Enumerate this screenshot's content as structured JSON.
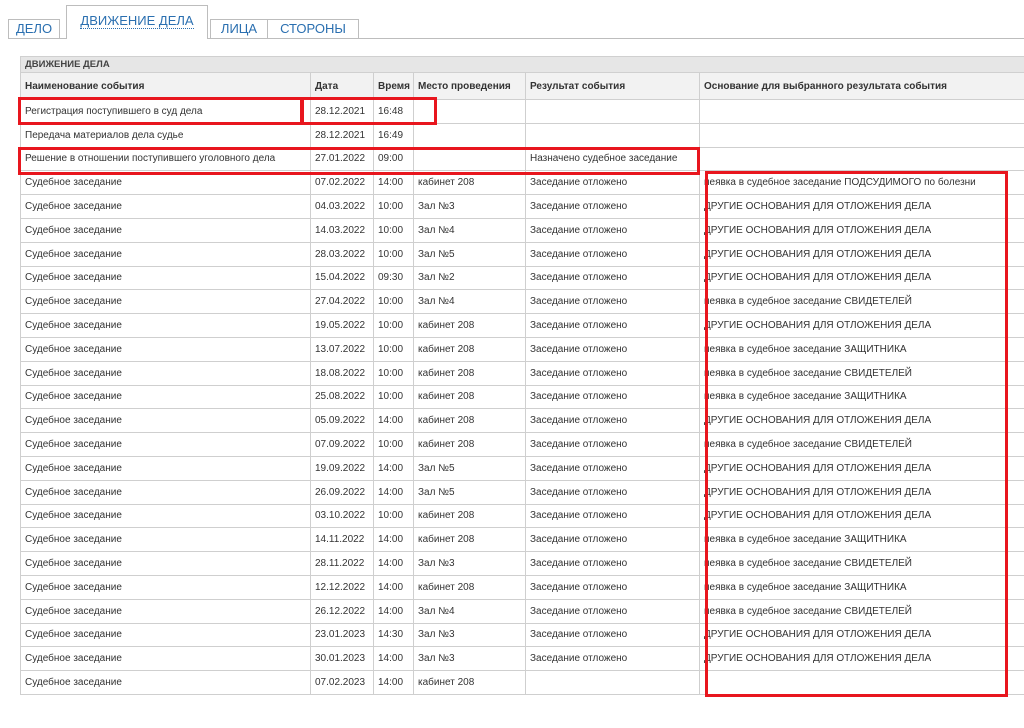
{
  "tabs": [
    {
      "label": "ДЕЛО"
    },
    {
      "label": "ДВИЖЕНИЕ ДЕЛА"
    },
    {
      "label": "ЛИЦА"
    },
    {
      "label": "СТОРОНЫ"
    }
  ],
  "section_title": "ДВИЖЕНИЕ ДЕЛА",
  "columns": [
    "Наименование события",
    "Дата",
    "Время",
    "Место проведения",
    "Результат события",
    "Основание для выбранного результата события"
  ],
  "rows": [
    {
      "name": "Регистрация поступившего в суд дела",
      "date": "28.12.2021",
      "time": "16:48",
      "place": "",
      "result": "",
      "reason": ""
    },
    {
      "name": "Передача материалов дела судье",
      "date": "28.12.2021",
      "time": "16:49",
      "place": "",
      "result": "",
      "reason": ""
    },
    {
      "name": "Решение в отношении поступившего уголовного дела",
      "date": "27.01.2022",
      "time": "09:00",
      "place": "",
      "result": "Назначено судебное заседание",
      "reason": ""
    },
    {
      "name": "Судебное заседание",
      "date": "07.02.2022",
      "time": "14:00",
      "place": "кабинет 208",
      "result": "Заседание отложено",
      "reason": "неявка в судебное заседание ПОДСУДИМОГО по болезни"
    },
    {
      "name": "Судебное заседание",
      "date": "04.03.2022",
      "time": "10:00",
      "place": "Зал №3",
      "result": "Заседание отложено",
      "reason": "ДРУГИЕ ОСНОВАНИЯ ДЛЯ ОТЛОЖЕНИЯ ДЕЛА"
    },
    {
      "name": "Судебное заседание",
      "date": "14.03.2022",
      "time": "10:00",
      "place": "Зал №4",
      "result": "Заседание отложено",
      "reason": "ДРУГИЕ ОСНОВАНИЯ ДЛЯ ОТЛОЖЕНИЯ ДЕЛА"
    },
    {
      "name": "Судебное заседание",
      "date": "28.03.2022",
      "time": "10:00",
      "place": "Зал №5",
      "result": "Заседание отложено",
      "reason": "ДРУГИЕ ОСНОВАНИЯ ДЛЯ ОТЛОЖЕНИЯ ДЕЛА"
    },
    {
      "name": "Судебное заседание",
      "date": "15.04.2022",
      "time": "09:30",
      "place": "Зал №2",
      "result": "Заседание отложено",
      "reason": "ДРУГИЕ ОСНОВАНИЯ ДЛЯ ОТЛОЖЕНИЯ ДЕЛА"
    },
    {
      "name": "Судебное заседание",
      "date": "27.04.2022",
      "time": "10:00",
      "place": "Зал №4",
      "result": "Заседание отложено",
      "reason": "неявка в судебное заседание СВИДЕТЕЛЕЙ"
    },
    {
      "name": "Судебное заседание",
      "date": "19.05.2022",
      "time": "10:00",
      "place": "кабинет 208",
      "result": "Заседание отложено",
      "reason": "ДРУГИЕ ОСНОВАНИЯ ДЛЯ ОТЛОЖЕНИЯ ДЕЛА"
    },
    {
      "name": "Судебное заседание",
      "date": "13.07.2022",
      "time": "10:00",
      "place": "кабинет 208",
      "result": "Заседание отложено",
      "reason": "неявка в судебное заседание ЗАЩИТНИКА"
    },
    {
      "name": "Судебное заседание",
      "date": "18.08.2022",
      "time": "10:00",
      "place": "кабинет 208",
      "result": "Заседание отложено",
      "reason": "неявка в судебное заседание СВИДЕТЕЛЕЙ"
    },
    {
      "name": "Судебное заседание",
      "date": "25.08.2022",
      "time": "10:00",
      "place": "кабинет 208",
      "result": "Заседание отложено",
      "reason": "неявка в судебное заседание ЗАЩИТНИКА"
    },
    {
      "name": "Судебное заседание",
      "date": "05.09.2022",
      "time": "14:00",
      "place": "кабинет 208",
      "result": "Заседание отложено",
      "reason": "ДРУГИЕ ОСНОВАНИЯ ДЛЯ ОТЛОЖЕНИЯ ДЕЛА"
    },
    {
      "name": "Судебное заседание",
      "date": "07.09.2022",
      "time": "10:00",
      "place": "кабинет 208",
      "result": "Заседание отложено",
      "reason": "неявка в судебное заседание СВИДЕТЕЛЕЙ"
    },
    {
      "name": "Судебное заседание",
      "date": "19.09.2022",
      "time": "14:00",
      "place": "Зал №5",
      "result": "Заседание отложено",
      "reason": "ДРУГИЕ ОСНОВАНИЯ ДЛЯ ОТЛОЖЕНИЯ ДЕЛА"
    },
    {
      "name": "Судебное заседание",
      "date": "26.09.2022",
      "time": "14:00",
      "place": "Зал №5",
      "result": "Заседание отложено",
      "reason": "ДРУГИЕ ОСНОВАНИЯ ДЛЯ ОТЛОЖЕНИЯ ДЕЛА"
    },
    {
      "name": "Судебное заседание",
      "date": "03.10.2022",
      "time": "10:00",
      "place": "кабинет 208",
      "result": "Заседание отложено",
      "reason": "ДРУГИЕ ОСНОВАНИЯ ДЛЯ ОТЛОЖЕНИЯ ДЕЛА"
    },
    {
      "name": "Судебное заседание",
      "date": "14.11.2022",
      "time": "14:00",
      "place": "кабинет 208",
      "result": "Заседание отложено",
      "reason": "неявка в судебное заседание ЗАЩИТНИКА"
    },
    {
      "name": "Судебное заседание",
      "date": "28.11.2022",
      "time": "14:00",
      "place": "Зал №3",
      "result": "Заседание отложено",
      "reason": "неявка в судебное заседание СВИДЕТЕЛЕЙ"
    },
    {
      "name": "Судебное заседание",
      "date": "12.12.2022",
      "time": "14:00",
      "place": "кабинет 208",
      "result": "Заседание отложено",
      "reason": "неявка в судебное заседание ЗАЩИТНИКА"
    },
    {
      "name": "Судебное заседание",
      "date": "26.12.2022",
      "time": "14:00",
      "place": "Зал №4",
      "result": "Заседание отложено",
      "reason": "неявка в судебное заседание СВИДЕТЕЛЕЙ"
    },
    {
      "name": "Судебное заседание",
      "date": "23.01.2023",
      "time": "14:30",
      "place": "Зал №3",
      "result": "Заседание отложено",
      "reason": "ДРУГИЕ ОСНОВАНИЯ ДЛЯ ОТЛОЖЕНИЯ ДЕЛА"
    },
    {
      "name": "Судебное заседание",
      "date": "30.01.2023",
      "time": "14:00",
      "place": "Зал №3",
      "result": "Заседание отложено",
      "reason": "ДРУГИЕ ОСНОВАНИЯ ДЛЯ ОТЛОЖЕНИЯ ДЕЛА"
    },
    {
      "name": "Судебное заседание",
      "date": "07.02.2023",
      "time": "14:00",
      "place": "кабинет 208",
      "result": "",
      "reason": ""
    }
  ],
  "colors": {
    "highlight": "#e8161e",
    "tab_text": "#2a6fb0",
    "section_bg": "#e6e6e6",
    "header_bg": "#f2f2f2"
  }
}
